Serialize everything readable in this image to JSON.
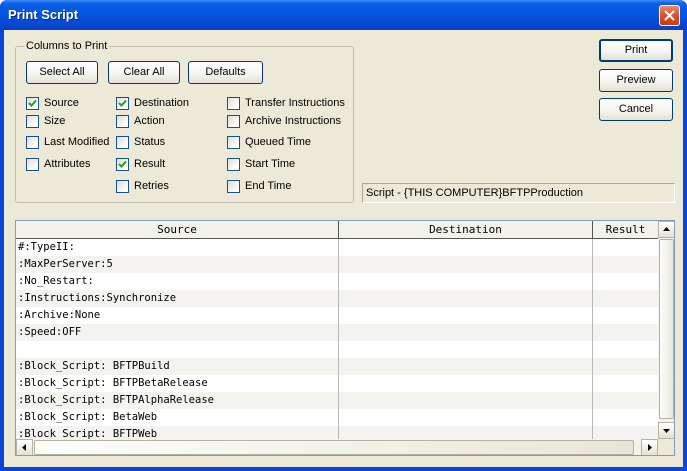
{
  "window": {
    "title": "Print Script"
  },
  "columns_group": {
    "legend": "Columns to Print",
    "select_all_label": "Select All",
    "clear_all_label": "Clear All",
    "defaults_label": "Defaults",
    "checkboxes": [
      {
        "label": "Source",
        "checked": true
      },
      {
        "label": "Destination",
        "checked": true
      },
      {
        "label": "Transfer Instructions",
        "checked": false
      },
      {
        "label": "Size",
        "checked": false
      },
      {
        "label": "Action",
        "checked": false
      },
      {
        "label": "Archive Instructions",
        "checked": false
      },
      {
        "label": "Last Modified",
        "checked": false
      },
      {
        "label": "Status",
        "checked": false
      },
      {
        "label": "Queued Time",
        "checked": false
      },
      {
        "label": "Attributes",
        "checked": false
      },
      {
        "label": "Result",
        "checked": true
      },
      {
        "label": "Start Time",
        "checked": false
      },
      {
        "label": "Retries",
        "checked": false
      },
      {
        "label": "End Time",
        "checked": false
      }
    ]
  },
  "actions": {
    "print_label": "Print",
    "preview_label": "Preview",
    "cancel_label": "Cancel"
  },
  "script_label": "Script - {THIS COMPUTER}BFTPProduction",
  "table": {
    "headers": [
      "Source",
      "Destination",
      "Result"
    ],
    "rows": [
      "#:TypeII:",
      ":MaxPerServer:5",
      ":No_Restart:",
      ":Instructions:Synchronize",
      ":Archive:None",
      ":Speed:OFF",
      "",
      ":Block_Script: BFTPBuild",
      ":Block_Script: BFTPBetaRelease",
      ":Block_Script: BFTPAlphaRelease",
      ":Block_Script: BetaWeb",
      ":Block_Script: BFTPWeb"
    ]
  }
}
